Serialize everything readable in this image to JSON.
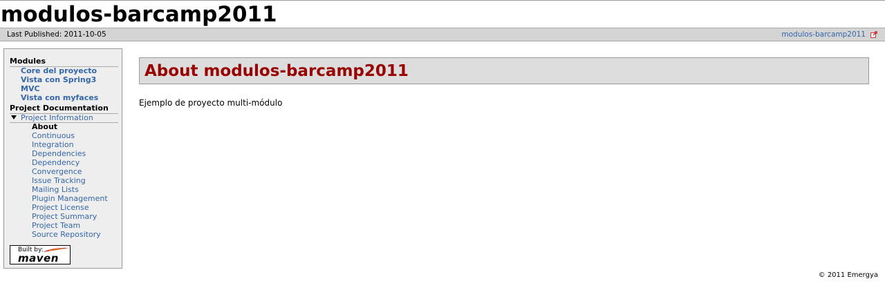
{
  "site": {
    "title": "modulos-barcamp2011"
  },
  "breadcrumb": {
    "last_published": "Last Published: 2011-10-05",
    "link_label": "modulos-barcamp2011"
  },
  "nav": {
    "modules_heading": "Modules",
    "modules": [
      "Core del proyecto",
      "Vista con Spring3",
      "MVC",
      "Vista con myfaces"
    ],
    "docs_heading": "Project Documentation",
    "project_info_label": "Project Information",
    "items": [
      "About",
      "Continuous",
      "Integration",
      "Dependencies",
      "Dependency",
      "Convergence",
      "Issue Tracking",
      "Mailing Lists",
      "Plugin Management",
      "Project License",
      "Project Summary",
      "Project Team",
      "Source Repository"
    ],
    "built_by": "Built by:",
    "maven": "maven"
  },
  "content": {
    "title": "About modulos-barcamp2011",
    "description": "Ejemplo de proyecto multi-módulo"
  },
  "footer": {
    "copyright": "© 2011 Emergya"
  },
  "colors": {
    "link": "#3366aa",
    "title": "#990000",
    "panel": "#eeeeee"
  }
}
